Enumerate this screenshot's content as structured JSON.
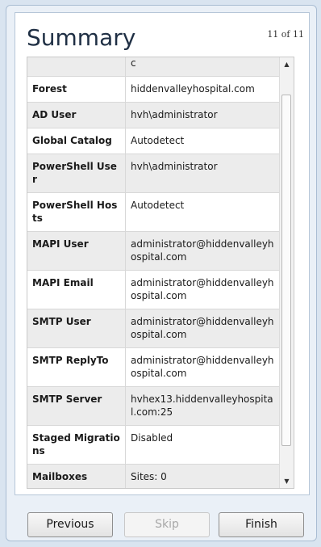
{
  "header": {
    "title": "Summary",
    "page_indicator": "11 of 11"
  },
  "summary": {
    "rows": [
      {
        "key": "",
        "value": "c"
      },
      {
        "key": "Forest",
        "value": "hiddenvalleyhospital.com"
      },
      {
        "key": "AD User",
        "value": "hvh\\administrator"
      },
      {
        "key": "Global Catalog",
        "value": "Autodetect"
      },
      {
        "key": "PowerShell User",
        "value": "hvh\\administrator"
      },
      {
        "key": "PowerShell Hosts",
        "value": "Autodetect"
      },
      {
        "key": "MAPI User",
        "value": "administrator@hiddenvalleyhospital.com"
      },
      {
        "key": "MAPI Email",
        "value": "administrator@hiddenvalleyhospital.com"
      },
      {
        "key": "SMTP User",
        "value": "administrator@hiddenvalleyhospital.com"
      },
      {
        "key": "SMTP ReplyTo",
        "value": "administrator@hiddenvalleyhospital.com"
      },
      {
        "key": "SMTP Server",
        "value": "hvhex13.hiddenvalleyhospital.com:25"
      },
      {
        "key": "Staged Migrations",
        "value": "Disabled"
      },
      {
        "key": "Mailboxes",
        "value": "Sites: 0"
      }
    ]
  },
  "footer": {
    "previous_label": "Previous",
    "skip_label": "Skip",
    "finish_label": "Finish"
  },
  "colors": {
    "frame_bg": "#eaf0f7",
    "odd_row": "#ececec",
    "even_row": "#ffffff"
  }
}
